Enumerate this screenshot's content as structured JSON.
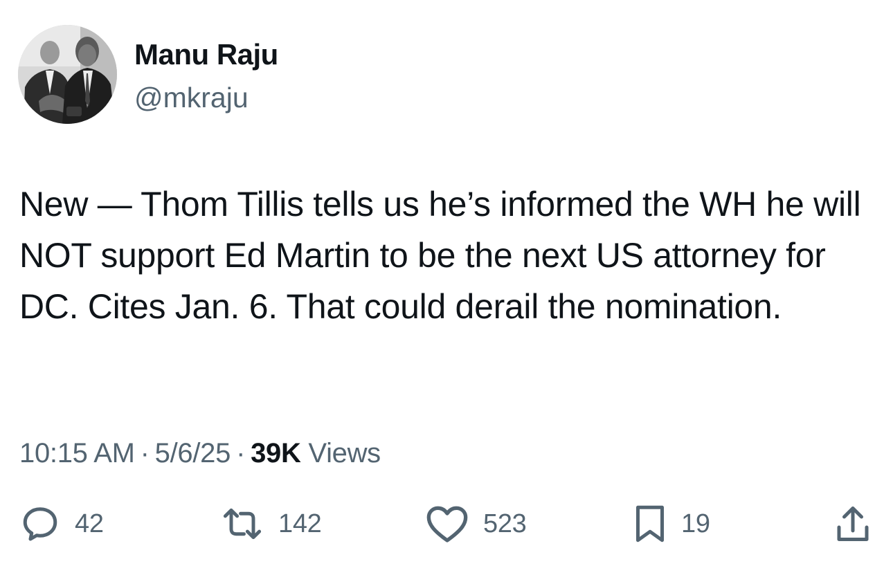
{
  "author": {
    "name": "Manu Raju",
    "handle": "@mkraju",
    "avatar_icon": "profile-photo"
  },
  "tweet": {
    "text": "New — Thom Tillis tells us he’s informed the WH he will NOT support Ed Martin to be the next US attorney for DC. Cites Jan. 6. That could derail the nomination.",
    "time": "10:15 AM",
    "date": "5/6/25",
    "separator": "·",
    "views_count": "39K",
    "views_label": "Views"
  },
  "actions": {
    "replies": "42",
    "reposts": "142",
    "likes": "523",
    "bookmarks": "19",
    "reply_icon": "reply-icon",
    "repost_icon": "repost-icon",
    "like_icon": "heart-icon",
    "bookmark_icon": "bookmark-icon",
    "share_icon": "share-icon"
  },
  "colors": {
    "text": "#0f1419",
    "secondary": "#536471",
    "background": "#ffffff"
  }
}
